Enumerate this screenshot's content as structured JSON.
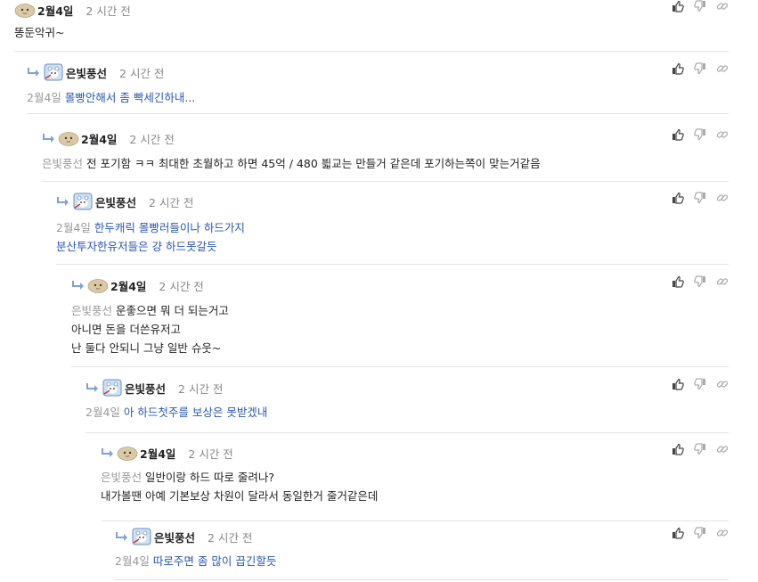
{
  "comments": [
    {
      "author": "2월4일",
      "time": "2 시간 전",
      "mention": "",
      "lines": [
        "똥둔악귀~"
      ],
      "avatar": "potato-avatar",
      "text_color": "dark"
    },
    {
      "author": "은빛풍선",
      "time": "2 시간 전",
      "mention": "2월4일",
      "lines": [
        "몰빵안해서 좀 빡세긴하내..."
      ],
      "avatar": "bear-avatar",
      "text_color": "blue"
    },
    {
      "author": "2월4일",
      "time": "2 시간 전",
      "mention": "은빛풍선",
      "lines": [
        "전 포기함 ㅋㅋ 최대한 초월하고 하면 45억 / 480 븳교는 만들거 같은데 포기하는쪽이 맞는거같음"
      ],
      "avatar": "potato-avatar",
      "text_color": "dark"
    },
    {
      "author": "은빛풍선",
      "time": "2 시간 전",
      "mention": "2월4일",
      "lines": [
        "한두캐릭 몰빵러들이나 하드가지",
        "분산투자한유저들은 걍 하드못갈듯"
      ],
      "avatar": "bear-avatar",
      "text_color": "blue"
    },
    {
      "author": "2월4일",
      "time": "2 시간 전",
      "mention": "은빛풍선",
      "lines": [
        "운좋으면 뭐 더 되는거고",
        "아니면 돈을 더쓴유저고",
        "난 둘다 안되니 그냥 일반 슈웃~"
      ],
      "avatar": "potato-avatar",
      "text_color": "dark"
    },
    {
      "author": "은빛풍선",
      "time": "2 시간 전",
      "mention": "2월4일",
      "lines": [
        "아 하드첫주를 보상은 못받겠내"
      ],
      "avatar": "bear-avatar",
      "text_color": "blue"
    },
    {
      "author": "2월4일",
      "time": "2 시간 전",
      "mention": "은빛풍선",
      "lines": [
        "일반이랑 하드 따로 줄려나?",
        "내가볼땐 아예 기본보상 차원이 달라서 동일한거 줄거같은데"
      ],
      "avatar": "potato-avatar",
      "text_color": "dark"
    },
    {
      "author": "은빛풍선",
      "time": "2 시간 전",
      "mention": "2월4일",
      "lines": [
        "따로주면 좀 많이 끕긴할듯"
      ],
      "avatar": "bear-avatar",
      "text_color": "blue"
    }
  ],
  "actions": {
    "like_icon": "thumbs-up-icon",
    "dislike_icon": "thumbs-down-icon",
    "link_icon": "link-icon"
  },
  "colors": {
    "reply_text": "#2a57b5",
    "mention": "#999999",
    "time": "#888888",
    "divider": "#e4e4e4"
  }
}
